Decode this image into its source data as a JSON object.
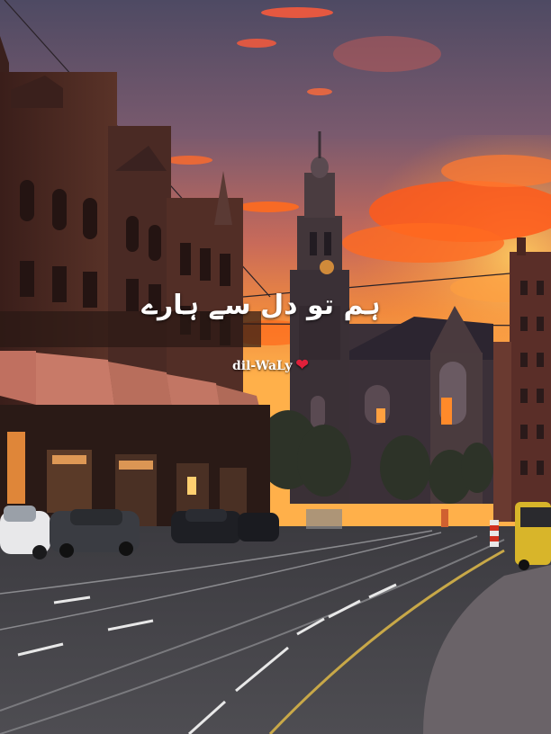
{
  "overlay": {
    "caption": "ہم تو دل سے ہارے",
    "signature": "dil-WaLy",
    "heart_icon": "❤"
  },
  "colors": {
    "sky_top": "#5a4f66",
    "sky_glow": "#ff7a2a",
    "cloud_fire": "#ff5a1f",
    "brick": "#5a2e26",
    "road": "#4b4a4f",
    "heart": "#e0203a"
  }
}
